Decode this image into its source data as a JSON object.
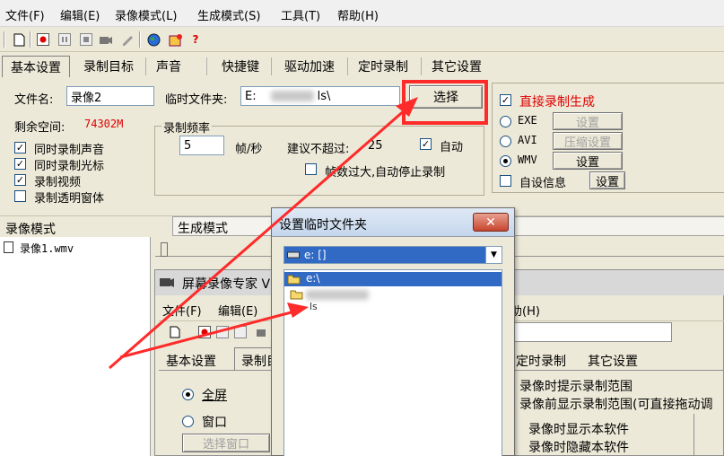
{
  "menu": [
    "文件(F)",
    "编辑(E)",
    "录像模式(L)",
    "生成模式(S)",
    "工具(T)",
    "帮助(H)"
  ],
  "toolbar_icons": [
    "new-icon",
    "record-icon",
    "pause-icon",
    "stop-icon",
    "camera-icon",
    "pen-icon",
    "globe-icon",
    "shop-icon",
    "help-icon"
  ],
  "tabs": [
    "基本设置",
    "录制目标",
    "声音",
    "快捷键",
    "驱动加速",
    "定时录制",
    "其它设置"
  ],
  "basic": {
    "filename_label": "文件名:",
    "filename_value": "录像2",
    "tempdir_label": "临时文件夹:",
    "tempdir_prefix": "E:",
    "tempdir_suffix": "ls\\",
    "select_btn": "选择",
    "space_label": "剩余空间:",
    "space_value": "74302M",
    "checks": [
      {
        "label": "同时录制声音",
        "checked": true
      },
      {
        "label": "同时录制光标",
        "checked": true
      },
      {
        "label": "录制视频",
        "checked": true
      },
      {
        "label": "录制透明窗体",
        "checked": false
      }
    ],
    "freq_title": "录制频率",
    "fps_value": "5",
    "fps_unit": "帧/秒",
    "suggest": "建议不超过:",
    "suggest_value": "25",
    "auto_label": "自动",
    "auto_stop_label": "帧数过大,自动停止录制"
  },
  "gen": {
    "direct_label": "直接录制生成",
    "exe_label": "EXE",
    "exe_btn": "设置",
    "avi_label": "AVI",
    "avi_btn": "压缩设置",
    "wmv_label": "WMV",
    "wmv_btn": "设置",
    "info_label": "自设信息",
    "info_btn": "设置"
  },
  "lower": {
    "left_header": "录像模式",
    "right_header": "生成模式",
    "file_item": "录像1.wmv"
  },
  "bg_window": {
    "title": "屏幕录像专家 V",
    "menu_file": "文件(F)",
    "menu_edit": "编辑(E)",
    "menu_help": "助(H)",
    "tab_basic": "基本设置",
    "tab_record": "录制目",
    "tab_timer": "定时录制",
    "tab_other": "其它设置",
    "fullscreen": "全屏",
    "window": "窗口",
    "select_window": "选择窗口",
    "right_lines": [
      "录像时提示录制范围",
      "录像前显示录制范围(可直接拖动调",
      "录像时显示本软件",
      "录像时隐藏本软件"
    ]
  },
  "dialog": {
    "title": "设置临时文件夹",
    "drive": "e: []",
    "folder_root": "e:\\",
    "folder_sub": "ls"
  },
  "colors": {
    "annotation": "#ff2a2a",
    "selection": "#316ac5",
    "red_text": "#e00000"
  }
}
